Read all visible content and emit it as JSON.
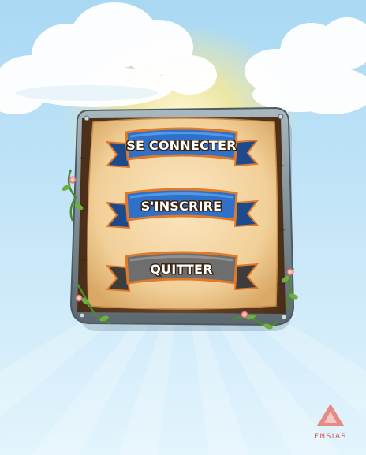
{
  "menu": {
    "buttons": [
      {
        "id": "login",
        "label": "SE CONNECTER",
        "color": "#2f70c9",
        "color_dark": "#1c4a8c",
        "color_light": "#5aa2ec"
      },
      {
        "id": "signup",
        "label": "S'INSCRIRE",
        "color": "#2f70c9",
        "color_dark": "#1c4a8c",
        "color_light": "#5aa2ec"
      },
      {
        "id": "quit",
        "label": "QUITTER",
        "color": "#6e6e6e",
        "color_dark": "#3d3d3d",
        "color_light": "#9a9a9a"
      }
    ]
  },
  "logo": {
    "text": "ENSIAS",
    "color": "#d9534f"
  },
  "colors": {
    "sky_top": "#aedbf4",
    "sky_bottom": "#e6f5fd",
    "parchment": "#f3d3a0",
    "wood": "#5a3a22",
    "frame": "#8a9aa3",
    "ribbon_outline": "#e07a2a"
  },
  "icons": [
    "flower-vine-icon",
    "cloud-icon",
    "sun-glow-icon",
    "ensias-logo-icon"
  ]
}
